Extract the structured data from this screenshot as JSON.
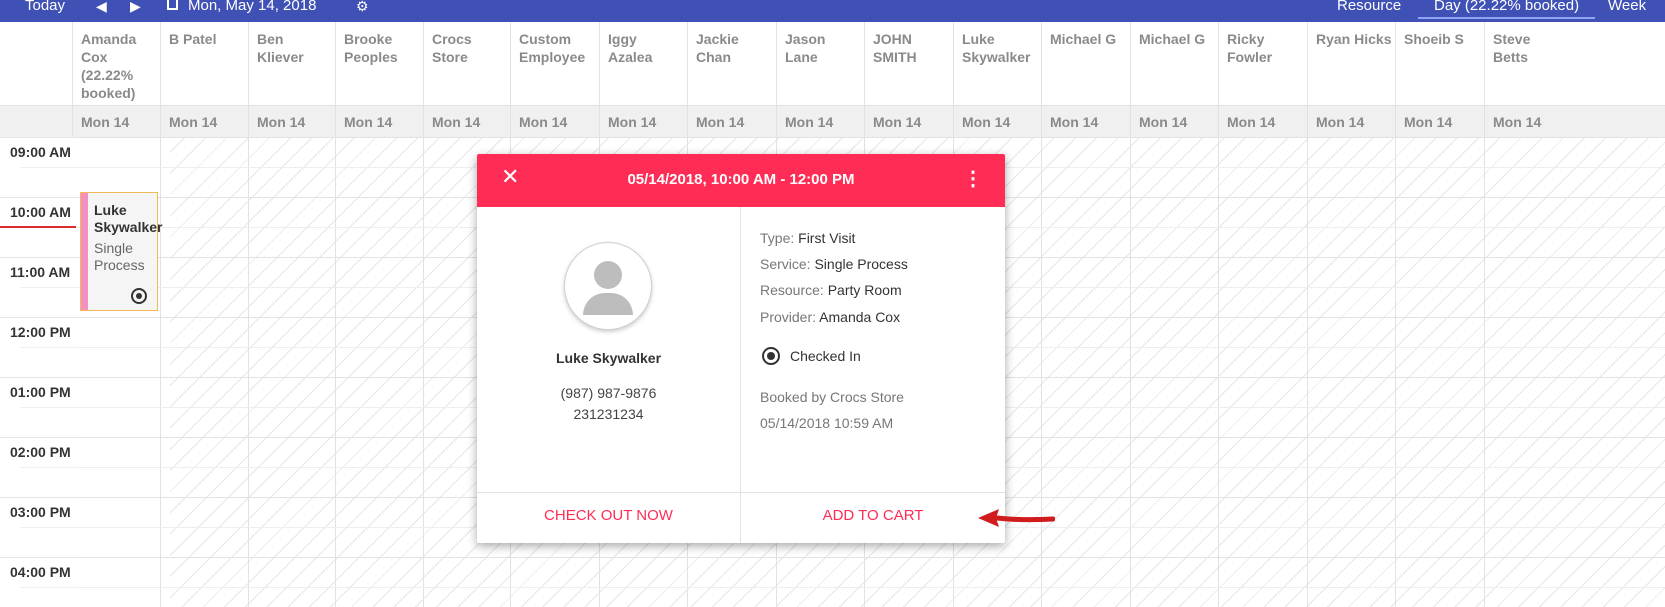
{
  "toolbar": {
    "today_label": "Today",
    "prev_icon": "chevron-left-icon",
    "next_icon": "chevron-right-icon",
    "calendar_icon": "calendar-icon",
    "date_label": "Mon, May 14, 2018",
    "settings_icon": "gear-icon",
    "view_resource": "Resource",
    "view_day": "Day (22.22% booked)",
    "view_week": "Week",
    "color": "#3f51b5"
  },
  "resources": [
    {
      "name": "Amanda Cox (22.22% booked)",
      "date": "Mon 14"
    },
    {
      "name": "B Patel",
      "date": "Mon 14"
    },
    {
      "name": "Ben Kliever",
      "date": "Mon 14"
    },
    {
      "name": "Brooke Peoples",
      "date": "Mon 14"
    },
    {
      "name": "Crocs Store",
      "date": "Mon 14"
    },
    {
      "name": "Custom Employee",
      "date": "Mon 14"
    },
    {
      "name": "Iggy Azalea",
      "date": "Mon 14"
    },
    {
      "name": "Jackie Chan",
      "date": "Mon 14"
    },
    {
      "name": "Jason Lane",
      "date": "Mon 14"
    },
    {
      "name": "JOHN SMITH",
      "date": "Mon 14"
    },
    {
      "name": "Luke Skywalker",
      "date": "Mon 14"
    },
    {
      "name": "Michael G",
      "date": "Mon 14"
    },
    {
      "name": "Michael G",
      "date": "Mon 14"
    },
    {
      "name": "Ricky Fowler",
      "date": "Mon 14"
    },
    {
      "name": "Ryan Hicks",
      "date": "Mon 14"
    },
    {
      "name": "Shoeib S",
      "date": "Mon 14"
    },
    {
      "name": "Steve Betts",
      "date": "Mon 14"
    }
  ],
  "times": [
    "09:00 AM",
    "10:00 AM",
    "11:00 AM",
    "12:00 PM",
    "01:00 PM",
    "02:00 PM",
    "03:00 PM",
    "04:00 PM"
  ],
  "event": {
    "client": "Luke Skywalker",
    "service": "Single Process",
    "status_icon": "checked-in-icon",
    "bar_color": "#f48fc2",
    "border_color": "#f2b955"
  },
  "popup": {
    "close_icon": "close-icon",
    "title": "05/14/2018, 10:00 AM - 12:00 PM",
    "menu_icon": "more-vert-icon",
    "header_color": "#ff2d56",
    "avatar_icon": "person-avatar-icon",
    "client_name": "Luke Skywalker",
    "phone": "(987) 987-9876",
    "client_id": "231231234",
    "type_label": "Type:",
    "type_value": "First Visit",
    "service_label": "Service:",
    "service_value": "Single Process",
    "resource_label": "Resource:",
    "resource_value": "Party Room",
    "provider_label": "Provider:",
    "provider_value": "Amanda Cox",
    "status_label": "Checked In",
    "booked_by": "Booked by Crocs Store",
    "booked_at": "05/14/2018 10:59 AM",
    "checkout_label": "CHECK OUT NOW",
    "cart_label": "ADD TO CART"
  },
  "annotation": {
    "arrow_icon": "red-arrow-icon",
    "color": "#d01c1c"
  }
}
